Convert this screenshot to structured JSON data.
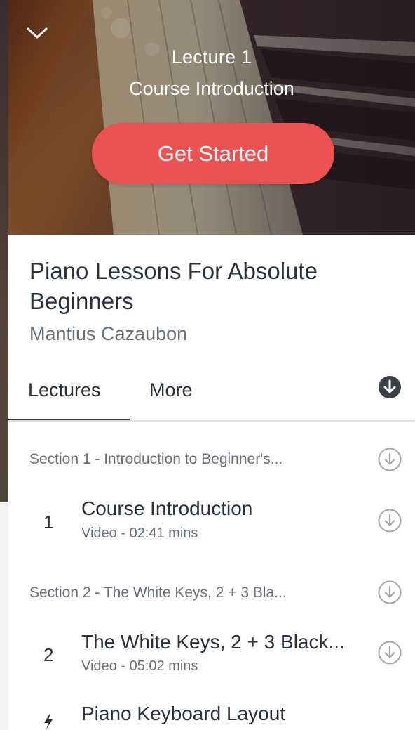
{
  "hero": {
    "lecture_label": "Lecture 1",
    "lecture_title": "Course Introduction",
    "cta_label": "Get Started",
    "cta_color": "#ec5252"
  },
  "course": {
    "title": "Piano Lessons For Absolute Beginners",
    "instructor": "Mantius Cazaubon"
  },
  "tabs": [
    {
      "label": "Lectures",
      "active": true
    },
    {
      "label": "More",
      "active": false
    }
  ],
  "icons": {
    "collapse": "chevron-down-icon",
    "download_all": "download-circle-filled-icon",
    "download": "download-circle-outline-icon",
    "quiz": "bolt-icon"
  },
  "curriculum": {
    "sections": [
      {
        "title": "Section 1 - Introduction to Beginner's...",
        "lectures": [
          {
            "number": "1",
            "title": "Course Introduction",
            "meta": "Video - 02:41 mins"
          }
        ]
      },
      {
        "title": "Section 2 - The White Keys, 2 + 3 Bla...",
        "lectures": [
          {
            "number": "2",
            "title": "The White Keys, 2 + 3 Black...",
            "meta": "Video - 05:02 mins"
          },
          {
            "number": "",
            "title": "Piano Keyboard Layout",
            "meta": ""
          }
        ]
      }
    ]
  }
}
